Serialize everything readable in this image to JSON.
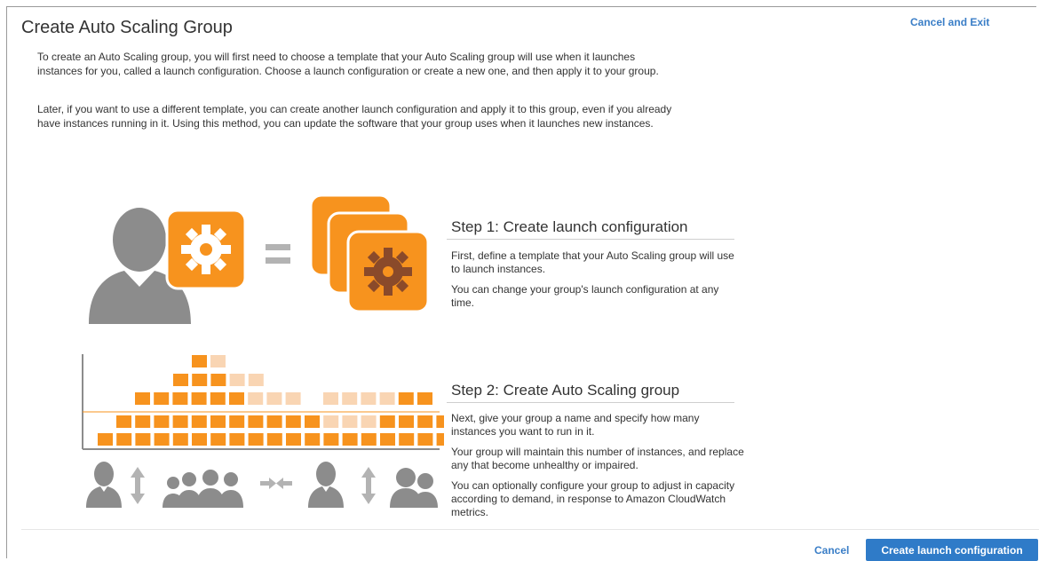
{
  "page": {
    "title": "Create Auto Scaling Group",
    "cancel_exit_label": "Cancel and Exit"
  },
  "intro": {
    "paragraph1": "To create an Auto Scaling group, you will first need to choose a template that your Auto Scaling group will use when it launches instances for you, called a launch configuration. Choose a launch configuration or create a new one, and then apply it to your group.",
    "paragraph2": "Later, if you want to use a different template, you can create another launch configuration and apply it to this group, even if you already have instances running in it. Using this method, you can update the software that your group uses when it launches new instances."
  },
  "step1": {
    "title": "Step 1: Create launch configuration",
    "text1": "First, define a template that your Auto Scaling group will use to launch instances.",
    "text2": "You can change your group's launch configuration at any time."
  },
  "step2": {
    "title": "Step 2: Create Auto Scaling group",
    "text1": "Next, give your group a name and specify how many instances you want to run in it.",
    "text2": "Your group will maintain this number of instances, and replace any that become unhealthy or impaired.",
    "text3": "You can optionally configure your group to adjust in capacity according to demand, in response to Amazon CloudWatch metrics."
  },
  "footer": {
    "cancel_label": "Cancel",
    "create_label": "Create launch configuration"
  },
  "colors": {
    "accent_orange": "#f7931e",
    "light_orange": "#f9d5b3",
    "dark_gear": "#8a4a2a",
    "gray_person": "#8c8c8c",
    "link_blue": "#3a7ec7",
    "button_blue": "#2f7bc8"
  },
  "icons": [
    "user-icon",
    "gear-icon",
    "equals-icon",
    "stacked-config-icon",
    "instance-grid-icon",
    "scale-arrows-icon",
    "user-group-icon"
  ]
}
